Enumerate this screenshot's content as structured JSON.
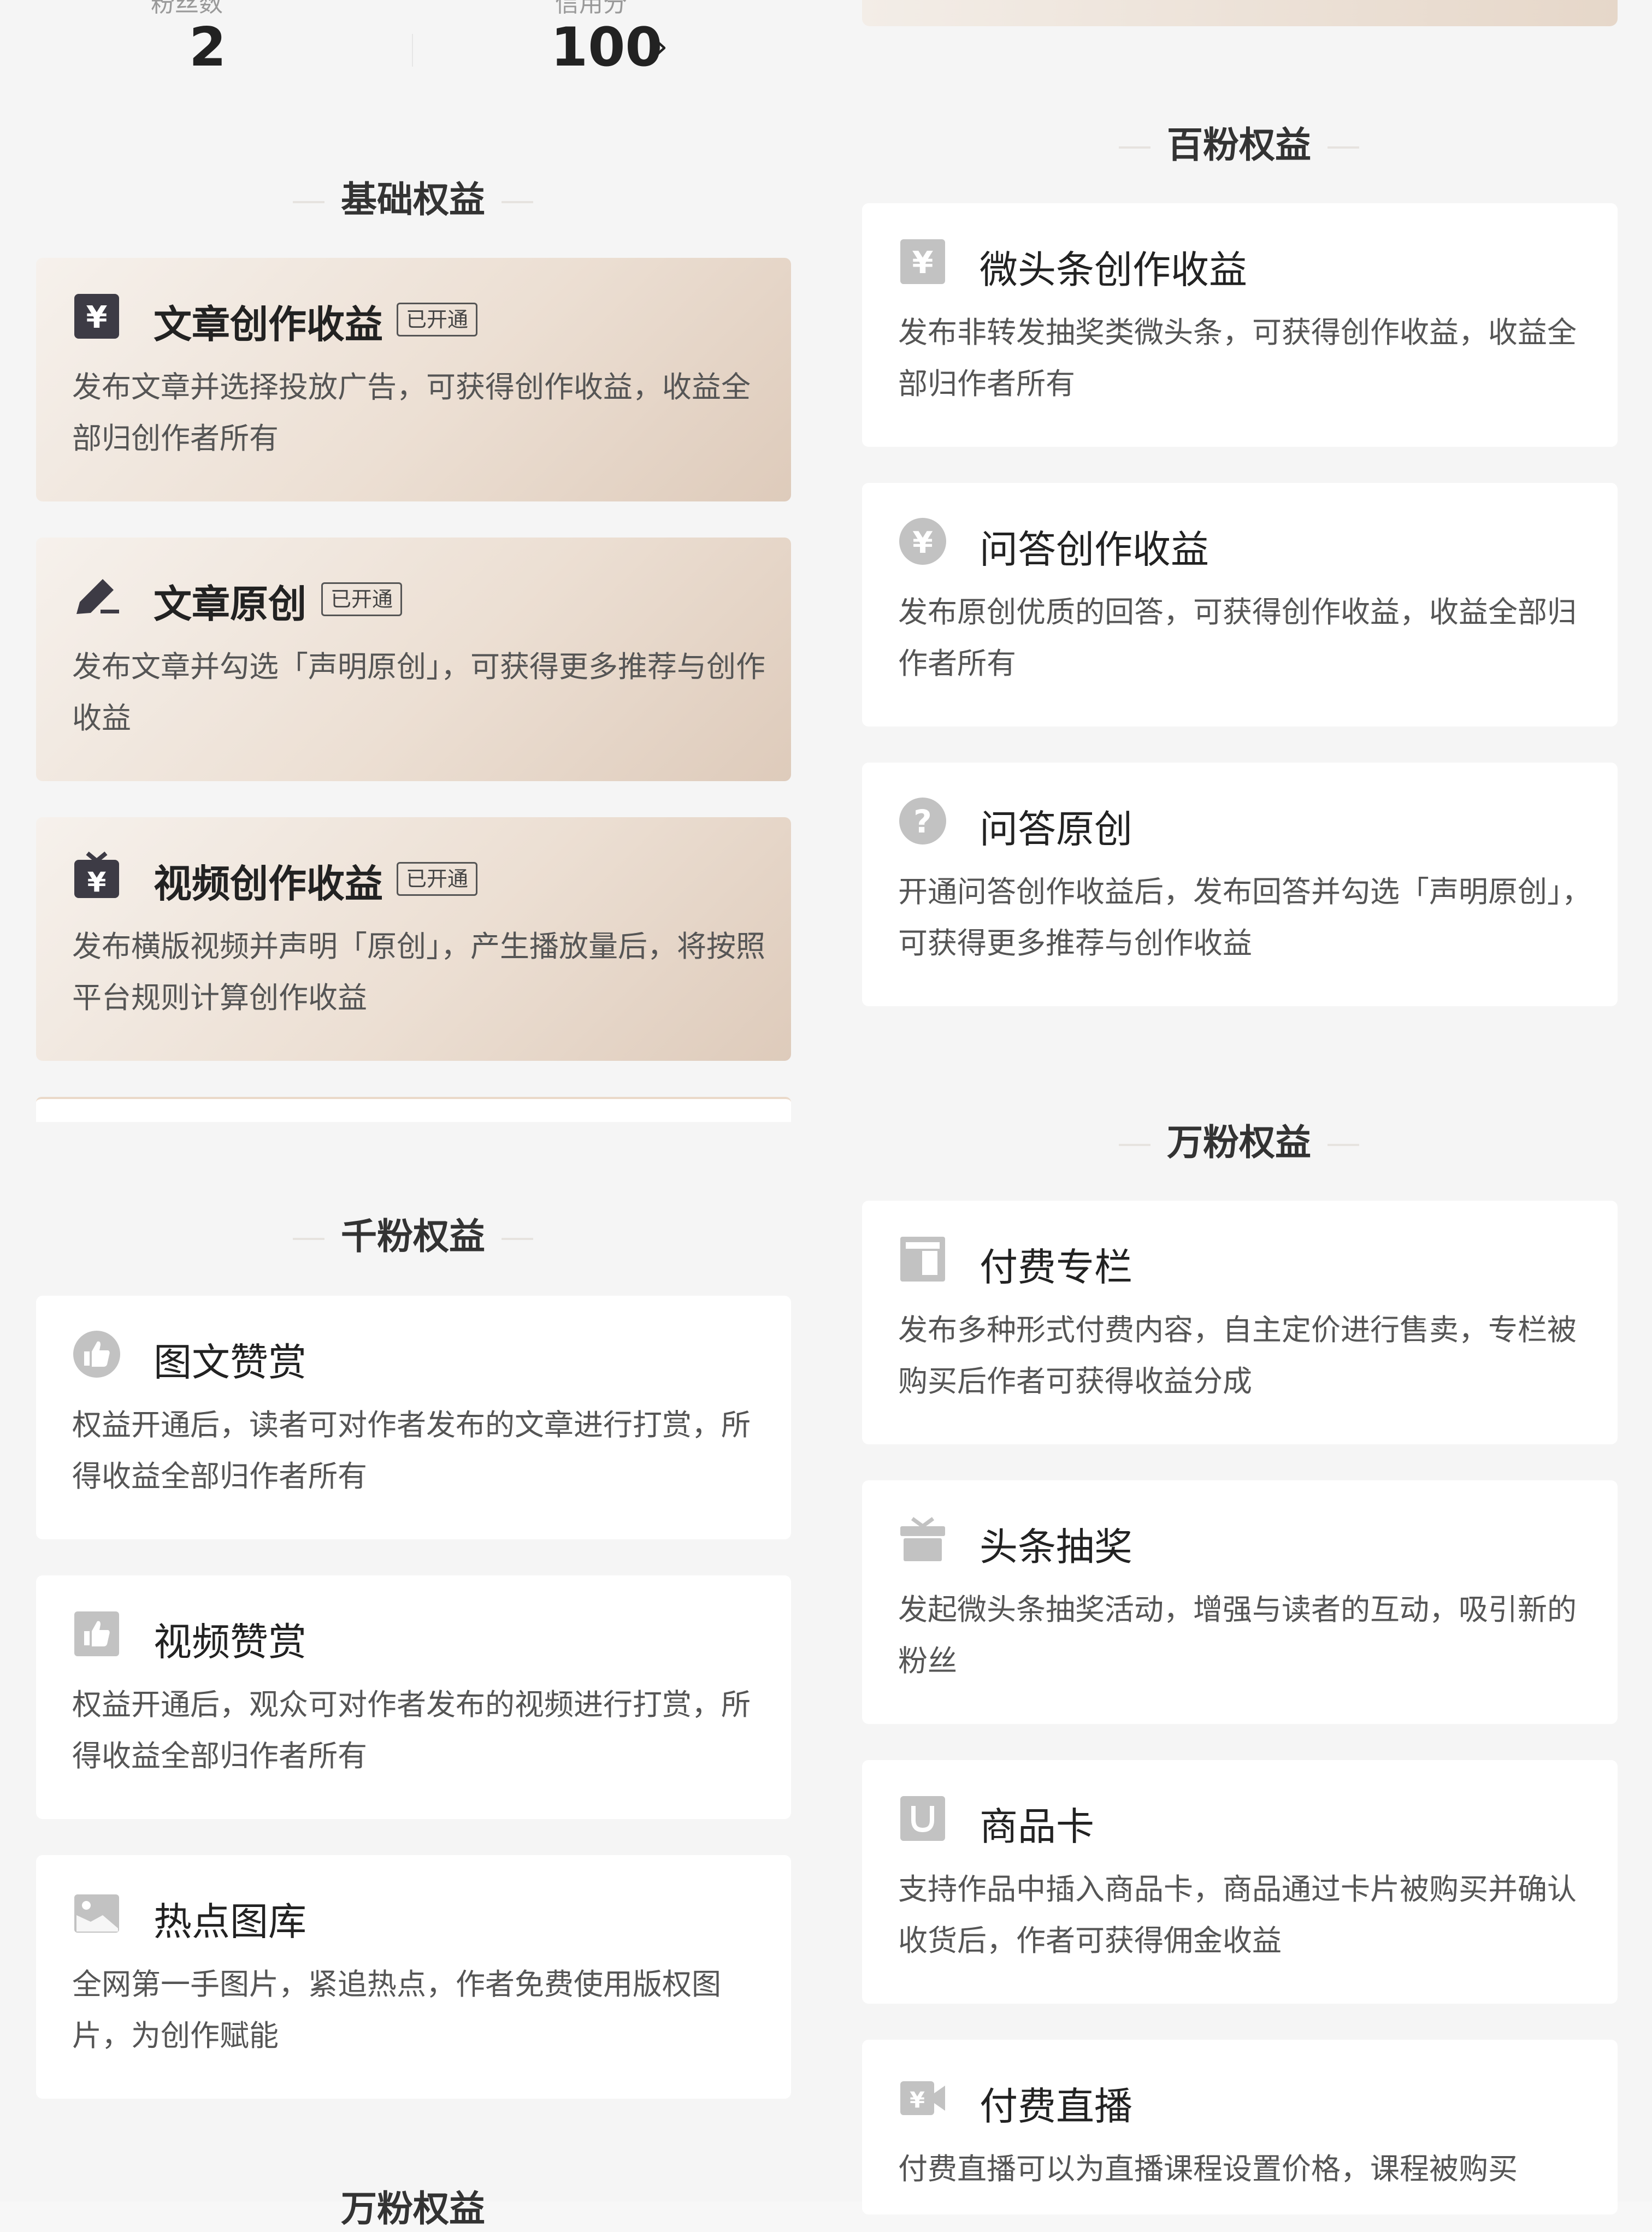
{
  "stats": {
    "left_value": "2",
    "right_value": "100",
    "left_label_partial": "粉丝数",
    "right_label_partial": "信用分"
  },
  "sections": {
    "basic": "基础权益",
    "thousand": "千粉权益",
    "hundred": "百粉权益",
    "tenk": "万粉权益",
    "next_partial": "万粉权益"
  },
  "badge": "已开通",
  "basic_items": [
    {
      "title": "文章创作收益",
      "desc": "发布文章并选择投放广告，可获得创作收益，收益全部归创作者所有",
      "icon": "yuan-square-icon"
    },
    {
      "title": "文章原创",
      "desc": "发布文章并勾选「声明原创」，可获得更多推荐与创作收益",
      "icon": "pen-icon"
    },
    {
      "title": "视频创作收益",
      "desc": "发布横版视频并声明「原创」，产生播放量后，将按照平台规则计算创作收益",
      "icon": "tv-yuan-icon"
    }
  ],
  "thousand_items": [
    {
      "title": "图文赞赏",
      "desc": "权益开通后，读者可对作者发布的文章进行打赏，所得收益全部归作者所有",
      "icon": "thumb-up-circle-icon"
    },
    {
      "title": "视频赞赏",
      "desc": "权益开通后，观众可对作者发布的视频进行打赏，所得收益全部归作者所有",
      "icon": "thumb-up-square-icon"
    },
    {
      "title": "热点图库",
      "desc": "全网第一手图片，紧追热点，作者免费使用版权图片，为创作赋能",
      "icon": "image-icon"
    }
  ],
  "hundred_items": [
    {
      "title": "微头条创作收益",
      "desc": "发布非转发抽奖类微头条，可获得创作收益，收益全部归作者所有",
      "icon": "yuan-square-icon"
    },
    {
      "title": "问答创作收益",
      "desc": "发布原创优质的回答，可获得创作收益，收益全部归作者所有",
      "icon": "yuan-circle-icon"
    },
    {
      "title": "问答原创",
      "desc": "开通问答创作收益后，发布回答并勾选「声明原创」，可获得更多推荐与创作收益",
      "icon": "question-icon"
    }
  ],
  "tenk_items": [
    {
      "title": "付费专栏",
      "desc": "发布多种形式付费内容，自主定价进行售卖，专栏被购买后作者可获得收益分成",
      "icon": "column-icon"
    },
    {
      "title": "头条抽奖",
      "desc": "发起微头条抽奖活动，增强与读者的互动，吸引新的粉丝",
      "icon": "gift-icon"
    },
    {
      "title": "商品卡",
      "desc": "支持作品中插入商品卡，商品通过卡片被购买并确认收货后，作者可获得佣金收益",
      "icon": "bag-icon"
    },
    {
      "title": "付费直播",
      "desc": "付费直播可以为直播课程设置价格，课程被购买",
      "icon": "video-yuan-icon"
    }
  ]
}
